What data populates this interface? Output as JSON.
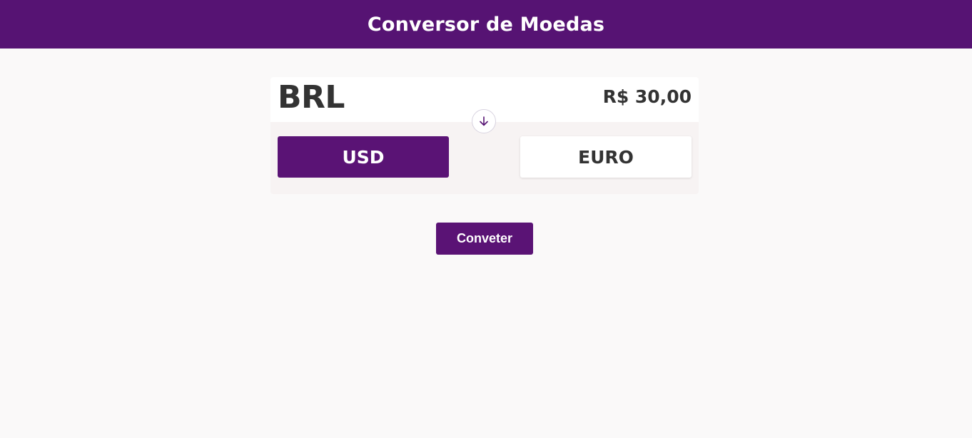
{
  "header": {
    "title": "Conversor de Moedas"
  },
  "converter": {
    "source_currency": "BRL",
    "amount": "R$ 30,00",
    "swap_icon": "arrow-down-icon",
    "target_options": [
      {
        "label": "USD",
        "selected": true
      },
      {
        "label": "EURO",
        "selected": false
      }
    ],
    "convert_label": "Conveter"
  },
  "colors": {
    "primary": "#561373",
    "text": "#333333",
    "background": "#faf9f9",
    "card_bottom": "#f7f3f3"
  }
}
